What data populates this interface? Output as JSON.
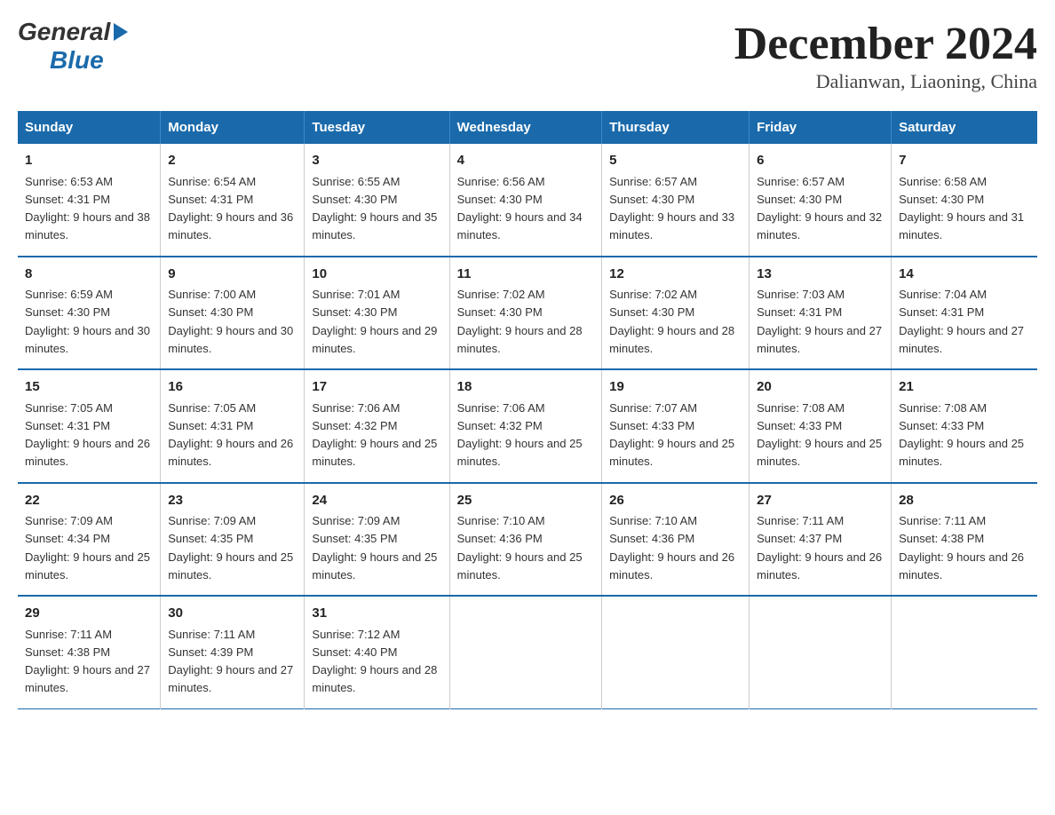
{
  "logo": {
    "general": "General",
    "blue": "Blue"
  },
  "title": "December 2024",
  "subtitle": "Dalianwan, Liaoning, China",
  "weekdays": [
    "Sunday",
    "Monday",
    "Tuesday",
    "Wednesday",
    "Thursday",
    "Friday",
    "Saturday"
  ],
  "weeks": [
    [
      {
        "day": "1",
        "sunrise": "6:53 AM",
        "sunset": "4:31 PM",
        "daylight": "9 hours and 38 minutes."
      },
      {
        "day": "2",
        "sunrise": "6:54 AM",
        "sunset": "4:31 PM",
        "daylight": "9 hours and 36 minutes."
      },
      {
        "day": "3",
        "sunrise": "6:55 AM",
        "sunset": "4:30 PM",
        "daylight": "9 hours and 35 minutes."
      },
      {
        "day": "4",
        "sunrise": "6:56 AM",
        "sunset": "4:30 PM",
        "daylight": "9 hours and 34 minutes."
      },
      {
        "day": "5",
        "sunrise": "6:57 AM",
        "sunset": "4:30 PM",
        "daylight": "9 hours and 33 minutes."
      },
      {
        "day": "6",
        "sunrise": "6:57 AM",
        "sunset": "4:30 PM",
        "daylight": "9 hours and 32 minutes."
      },
      {
        "day": "7",
        "sunrise": "6:58 AM",
        "sunset": "4:30 PM",
        "daylight": "9 hours and 31 minutes."
      }
    ],
    [
      {
        "day": "8",
        "sunrise": "6:59 AM",
        "sunset": "4:30 PM",
        "daylight": "9 hours and 30 minutes."
      },
      {
        "day": "9",
        "sunrise": "7:00 AM",
        "sunset": "4:30 PM",
        "daylight": "9 hours and 30 minutes."
      },
      {
        "day": "10",
        "sunrise": "7:01 AM",
        "sunset": "4:30 PM",
        "daylight": "9 hours and 29 minutes."
      },
      {
        "day": "11",
        "sunrise": "7:02 AM",
        "sunset": "4:30 PM",
        "daylight": "9 hours and 28 minutes."
      },
      {
        "day": "12",
        "sunrise": "7:02 AM",
        "sunset": "4:30 PM",
        "daylight": "9 hours and 28 minutes."
      },
      {
        "day": "13",
        "sunrise": "7:03 AM",
        "sunset": "4:31 PM",
        "daylight": "9 hours and 27 minutes."
      },
      {
        "day": "14",
        "sunrise": "7:04 AM",
        "sunset": "4:31 PM",
        "daylight": "9 hours and 27 minutes."
      }
    ],
    [
      {
        "day": "15",
        "sunrise": "7:05 AM",
        "sunset": "4:31 PM",
        "daylight": "9 hours and 26 minutes."
      },
      {
        "day": "16",
        "sunrise": "7:05 AM",
        "sunset": "4:31 PM",
        "daylight": "9 hours and 26 minutes."
      },
      {
        "day": "17",
        "sunrise": "7:06 AM",
        "sunset": "4:32 PM",
        "daylight": "9 hours and 25 minutes."
      },
      {
        "day": "18",
        "sunrise": "7:06 AM",
        "sunset": "4:32 PM",
        "daylight": "9 hours and 25 minutes."
      },
      {
        "day": "19",
        "sunrise": "7:07 AM",
        "sunset": "4:33 PM",
        "daylight": "9 hours and 25 minutes."
      },
      {
        "day": "20",
        "sunrise": "7:08 AM",
        "sunset": "4:33 PM",
        "daylight": "9 hours and 25 minutes."
      },
      {
        "day": "21",
        "sunrise": "7:08 AM",
        "sunset": "4:33 PM",
        "daylight": "9 hours and 25 minutes."
      }
    ],
    [
      {
        "day": "22",
        "sunrise": "7:09 AM",
        "sunset": "4:34 PM",
        "daylight": "9 hours and 25 minutes."
      },
      {
        "day": "23",
        "sunrise": "7:09 AM",
        "sunset": "4:35 PM",
        "daylight": "9 hours and 25 minutes."
      },
      {
        "day": "24",
        "sunrise": "7:09 AM",
        "sunset": "4:35 PM",
        "daylight": "9 hours and 25 minutes."
      },
      {
        "day": "25",
        "sunrise": "7:10 AM",
        "sunset": "4:36 PM",
        "daylight": "9 hours and 25 minutes."
      },
      {
        "day": "26",
        "sunrise": "7:10 AM",
        "sunset": "4:36 PM",
        "daylight": "9 hours and 26 minutes."
      },
      {
        "day": "27",
        "sunrise": "7:11 AM",
        "sunset": "4:37 PM",
        "daylight": "9 hours and 26 minutes."
      },
      {
        "day": "28",
        "sunrise": "7:11 AM",
        "sunset": "4:38 PM",
        "daylight": "9 hours and 26 minutes."
      }
    ],
    [
      {
        "day": "29",
        "sunrise": "7:11 AM",
        "sunset": "4:38 PM",
        "daylight": "9 hours and 27 minutes."
      },
      {
        "day": "30",
        "sunrise": "7:11 AM",
        "sunset": "4:39 PM",
        "daylight": "9 hours and 27 minutes."
      },
      {
        "day": "31",
        "sunrise": "7:12 AM",
        "sunset": "4:40 PM",
        "daylight": "9 hours and 28 minutes."
      },
      null,
      null,
      null,
      null
    ]
  ]
}
